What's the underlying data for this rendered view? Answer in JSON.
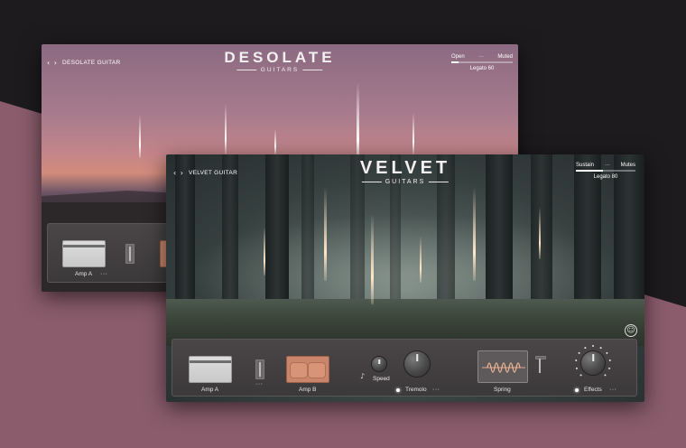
{
  "background": {
    "dark": "#1d1b1d",
    "accent": "#8a5c6c"
  },
  "desolate": {
    "nav": "‹ ›",
    "instrument_name": "DESOLATE GUITAR",
    "logo_title": "DESOLATE",
    "logo_subtitle": "GUITARS",
    "articulation": {
      "left": "Open",
      "mid": "···",
      "right": "Muted",
      "legato_label": "Legato",
      "legato_value": "60",
      "level": 0.12
    },
    "amp_label": "Amp A",
    "amp_more": "···"
  },
  "velvet": {
    "nav": "‹ ›",
    "instrument_name": "VELVET GUITAR",
    "logo_title": "VELVET",
    "logo_subtitle": "GUITARS",
    "articulation": {
      "left": "Sustain",
      "mid": "···",
      "right": "Mutes",
      "legato_label": "Legato",
      "legato_value": "80",
      "level": 0.45
    },
    "accessibility_icon": "accessibility-icon",
    "controls": {
      "amp_a_label": "Amp A",
      "amp_b_label": "Amp B",
      "mixer_more": "···",
      "speed_label": "Speed",
      "tremolo_label": "Tremolo",
      "tremolo_more": "···",
      "spring_label": "Spring",
      "effects_label": "Effects",
      "effects_more": "···",
      "note_icon": "♪"
    }
  }
}
